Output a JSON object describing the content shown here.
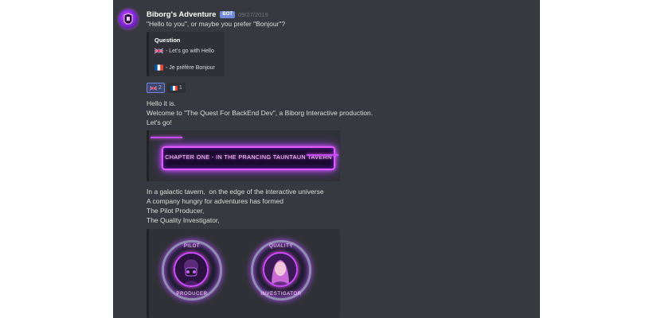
{
  "message": {
    "author": "Biborg's Adventure",
    "bot_tag": "BOT",
    "timestamp": "09/27/2019",
    "intro": "\"Hello to you\", or maybe you prefer \"Bonjour\"?"
  },
  "poll": {
    "title": "Question",
    "options": [
      {
        "flag": "uk-flag-icon",
        "label": "- Let's go with Hello"
      },
      {
        "flag": "france-flag-icon",
        "label": "- Je préfère Bonjour"
      }
    ]
  },
  "reactions": [
    {
      "flag": "uk-flag-icon",
      "count": "2",
      "active": true
    },
    {
      "flag": "france-flag-icon",
      "count": "1",
      "active": false
    }
  ],
  "reply": {
    "line1": "Hello it is.",
    "line2": "Welcome to \"The Quest For BackEnd Dev\", a Biborg Interactive production.",
    "line3": "Let's go!"
  },
  "chapter_banner": {
    "text": "CHAPTER ONE - IN THE PRANCING TAUNTAUN TAVERN"
  },
  "story": {
    "line1": "In a galactic tavern,  on the edge of the interactive universe",
    "line2": "A company hungry for adventures has formed",
    "line3": "The Pilot Producer,",
    "line4": "The Quality Investigator,"
  },
  "badges": [
    {
      "top": "PILOT",
      "bottom": "PRODUCER"
    },
    {
      "top": "QUALITY",
      "bottom": "INVESTIGATOR"
    }
  ],
  "colors": {
    "background": "#36393f",
    "embed": "#2f3136",
    "text": "#dcddde",
    "blurple": "#7289da",
    "neon": "#e35bff"
  }
}
